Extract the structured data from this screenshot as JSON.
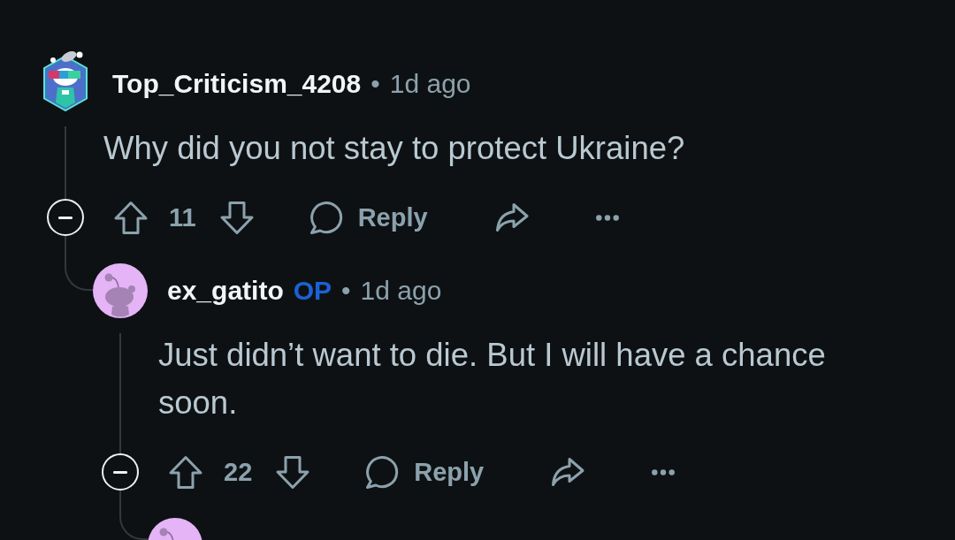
{
  "comments": [
    {
      "avatar": {
        "kind": "hexagon"
      },
      "author": "Top_Criticism_4208",
      "separator": "•",
      "time": "1d ago",
      "body": "Why did you not stay to protect Ukraine?",
      "expanded": true,
      "votes": "11",
      "reply_label": "Reply",
      "replies": [
        {
          "avatar": {
            "kind": "snoo"
          },
          "author": "ex_gatito",
          "op_badge": "OP",
          "separator": "•",
          "time": "1d ago",
          "body": "Just didn’t want to die. But I will have a chance soon.",
          "expanded": true,
          "votes": "22",
          "reply_label": "Reply",
          "replies": [
            {
              "avatar": {
                "kind": "snoo"
              }
            }
          ]
        }
      ]
    }
  ]
}
